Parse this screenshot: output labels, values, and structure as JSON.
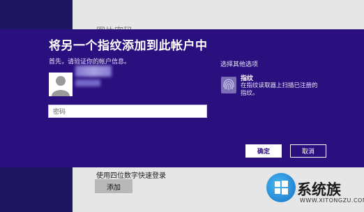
{
  "background": {
    "title_ghost": "图片密码",
    "pin_label": "使用四位数字快速登录",
    "add_button": "添加"
  },
  "dialog": {
    "title": "将另一个指纹添加到此帐户中",
    "verify_prompt": "首先，请验证你的帐户信息。",
    "password_placeholder": "密码",
    "other_options_label": "选择其他选项",
    "fingerprint_option": {
      "title": "指纹",
      "description": "在指纹读取器上扫描已注册的指纹。"
    },
    "ok_button": "确定",
    "cancel_button": "取消"
  },
  "watermark": {
    "text": "系统族",
    "url": "WWW.XITONGZU.COM"
  },
  "colors": {
    "dialog_bg": "#2a0f7e",
    "accent_dark": "#1e1660"
  },
  "icons": {
    "avatar": "user-avatar-icon",
    "fingerprint": "fingerprint-icon",
    "logo": "windows-logo-icon"
  }
}
